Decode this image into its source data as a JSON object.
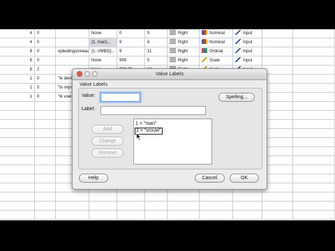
{
  "grid": {
    "rows": [
      {
        "c1": "4",
        "c2": "0",
        "c3": "",
        "c4": "None",
        "c5": "0",
        "c6": "5",
        "align": "Right",
        "measure": "Nominal",
        "measure_icon": "nominal-icon",
        "role": "Input"
      },
      {
        "c1": "4",
        "c2": "0",
        "c3": "",
        "c4": "{1, man}...",
        "c5": "9",
        "c6": "6",
        "align": "Right",
        "measure": "Nominal",
        "measure_icon": "nominal-icon",
        "role": "Input"
      },
      {
        "c1": "8",
        "c2": "0",
        "c3": "opleidingsniveau",
        "c4": "{1, VMBO}...",
        "c5": "9",
        "c6": "11",
        "align": "Right",
        "measure": "Ordinal",
        "measure_icon": "ordinal-icon",
        "role": "Input"
      },
      {
        "c1": "8",
        "c2": "0",
        "c3": "",
        "c4": "None",
        "c5": "999",
        "c6": "5",
        "align": "Right",
        "measure": "Scale",
        "measure_icon": "scale-icon",
        "role": "Input"
      },
      {
        "c1": "8",
        "c2": "2",
        "c3": "",
        "c4": "None",
        "c5": "999.00",
        "c6": "10",
        "align": "Right",
        "measure": "Scale",
        "measure_icon": "scale-icon",
        "role": "Input"
      },
      {
        "c1": "1",
        "c2": "0",
        "c3": "\"Ik denk",
        "c4": "",
        "c5": "",
        "c6": "",
        "align": "",
        "measure": "",
        "measure_icon": "",
        "role": ""
      },
      {
        "c1": "1",
        "c2": "0",
        "c3": "\"In mijn c",
        "c4": "",
        "c5": "",
        "c6": "",
        "align": "",
        "measure": "",
        "measure_icon": "",
        "role": ""
      },
      {
        "c1": "1",
        "c2": "0",
        "c3": "\"Ik voel",
        "c4": "",
        "c5": "",
        "c6": "",
        "align": "",
        "measure": "",
        "measure_icon": "",
        "role": ""
      }
    ]
  },
  "dialog": {
    "title": "Value Labels",
    "group_title": "Value Labels",
    "value_label": "Value:",
    "value_input": "",
    "label_label": "Label:",
    "label_input": "",
    "spelling_button": "Spelling...",
    "add_button": "Add",
    "change_button": "Change",
    "remove_button": "Remove",
    "labels": [
      "1 = \"man\"",
      "2 = \"vrouw\""
    ],
    "selected_index": 1,
    "help_button": "Help",
    "cancel_button": "Cancel",
    "ok_button": "OK"
  }
}
